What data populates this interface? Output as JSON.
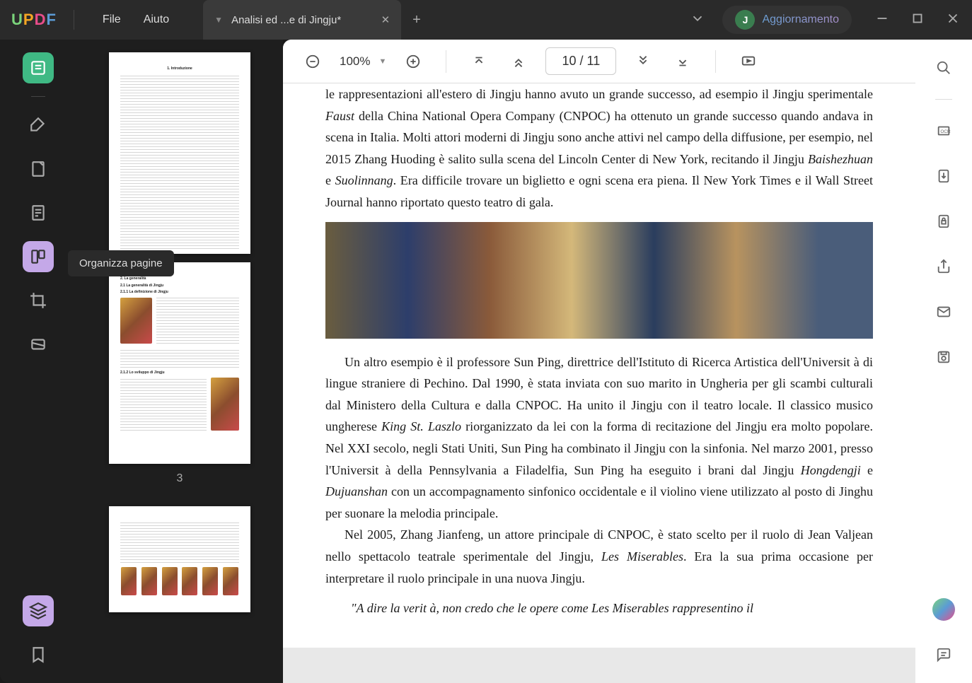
{
  "titlebar": {
    "menu_file": "File",
    "menu_help": "Aiuto",
    "tab_title": "Analisi ed ...e di Jingju*",
    "account_initial": "J",
    "account_label": "Aggiornamento"
  },
  "left_tools": {
    "tooltip_organize": "Organizza pagine"
  },
  "thumbnails": {
    "page3_label": "3"
  },
  "doc_toolbar": {
    "zoom": "100%",
    "page_current": "10",
    "page_total": "11"
  },
  "document": {
    "p1_prefix": "le rappresentazioni all'estero di Jingju hanno avuto un grande successo, ad esempio il Jingju sperimentale ",
    "p1_em1": "Faust",
    "p1_mid": " della China National Opera Company (CNPOC) ha ottenuto un grande successo quando andava in scena in Italia. Molti attori moderni di Jingju sono anche attivi nel campo della diffusione, per esempio, nel 2015 Zhang Huoding  è salito sulla scena del Lincoln Center di New York, recitando il Jingju ",
    "p1_em2": "Baishezhuan",
    "p1_and": " e ",
    "p1_em3": "Suolinnang",
    "p1_tail": ". Era difficile trovare un biglietto e ogni scena era piena. Il New York Times e il Wall Street Journal hanno riportato questo teatro di gala.",
    "p2_prefix": "Un altro esempio  è il professore Sun Ping, direttrice dell'Istituto di Ricerca Artistica dell'Universit à di lingue straniere di Pechino. Dal 1990,  è stata inviata con suo marito in Ungheria per gli scambi culturali dal Ministero della Cultura e dalla CNPOC. Ha unito il Jingju con il teatro locale. Il classico musico ungherese ",
    "p2_em1": "King St. Laszlo",
    "p2_mid": " riorganizzato da lei con la forma di recitazione del Jingju era molto popolare. Nel XXI secolo, negli Stati Uniti, Sun Ping ha combinato il Jingju con la sinfonia. Nel marzo 2001, presso l'Universit à della Pennsylvania a Filadelfia, Sun Ping ha eseguito i brani dal Jingju ",
    "p2_em2": "Hongdengji",
    "p2_and": " e ",
    "p2_em3": "Dujuanshan",
    "p2_tail": " con un accompagnamento sinfonico occidentale e il violino viene utilizzato al posto di Jinghu per suonare la melodia principale.",
    "p3_prefix": "Nel 2005, Zhang Jianfeng, un attore principale di CNPOC,  è stato scelto per il ruolo di Jean Valjean nello spettacolo teatrale sperimentale del Jingju, ",
    "p3_em1": "Les Miserables",
    "p3_tail": ". Era la sua prima occasione per interpretare il ruolo principale in una nuova Jingju.",
    "quote": "\"A dire la verit à, non credo che le opere come Les Miserables rappresentino il"
  }
}
